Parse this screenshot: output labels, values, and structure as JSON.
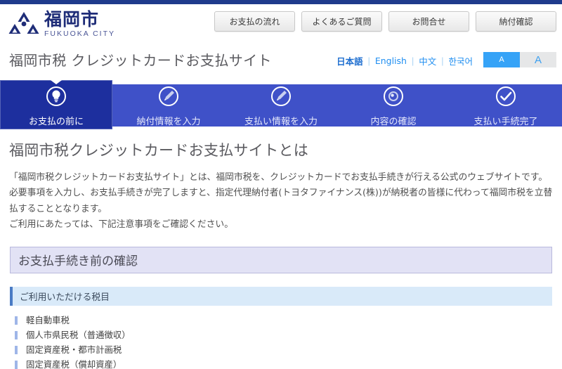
{
  "colors": {
    "brand_navy": "#1f3b8c",
    "step_bar": "#3f51c8",
    "step_active": "#1d2f9e",
    "link_blue": "#1f8ef1",
    "section_lavender": "#e2e2f5",
    "subsection_blue": "#d9eaf9",
    "bullet_blue": "#9fb6e8"
  },
  "header": {
    "logo": {
      "icon": "fukuoka-city-triangle-logo",
      "jp": "福岡市",
      "en": "FUKUOKA CITY"
    },
    "nav_buttons": [
      {
        "label": "お支払の流れ",
        "name": "payment-flow-button"
      },
      {
        "label": "よくあるご質問",
        "name": "faq-button"
      },
      {
        "label": "お問合せ",
        "name": "contact-button"
      },
      {
        "label": "納付確認",
        "name": "payment-confirmation-button"
      }
    ]
  },
  "title_row": {
    "site_title": "福岡市税 クレジットカードお支払サイト",
    "languages": [
      {
        "label": "日本語",
        "active": true
      },
      {
        "label": "English",
        "active": false
      },
      {
        "label": "中文",
        "active": false
      },
      {
        "label": "한국어",
        "active": false
      }
    ],
    "lang_separator": "|",
    "font_size": {
      "small_label": "A",
      "large_label": "A",
      "selected": "small"
    }
  },
  "steps": [
    {
      "label": "お支払の前に",
      "icon": "lightbulb-icon",
      "active": true
    },
    {
      "label": "納付情報を入力",
      "icon": "pencil-icon",
      "active": false
    },
    {
      "label": "支払い情報を入力",
      "icon": "pencil-icon",
      "active": false
    },
    {
      "label": "内容の確認",
      "icon": "magnifier-circle-icon",
      "active": false
    },
    {
      "label": "支払い手続完了",
      "icon": "check-circle-icon",
      "active": false
    }
  ],
  "main": {
    "page_heading": "福岡市税クレジットカードお支払サイトとは",
    "lead_paragraphs": [
      "「福岡市税クレジットカードお支払サイト」とは、福岡市税を、クレジットカードでお支払手続きが行える公式のウェブサイトです。",
      "必要事項を入力し、お支払手続きが完了しますと、指定代理納付者(トヨタファイナンス(株))が納税者の皆様に代わって福岡市税を立替",
      "払することとなります。",
      "ご利用にあたっては、下記注意事項をご確認ください。"
    ],
    "section_title": "お支払手続き前の確認",
    "subsection_title": "ご利用いただける税目",
    "tax_items": [
      "軽自動車税",
      "個人市県民税（普通徴収）",
      "固定資産税・都市計画税",
      "固定資産税（償却資産）"
    ]
  }
}
